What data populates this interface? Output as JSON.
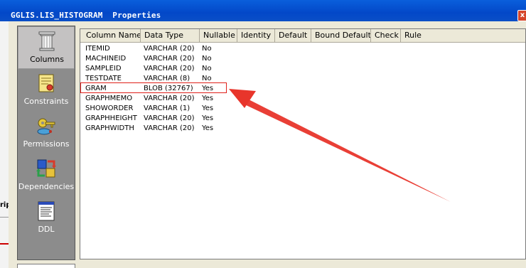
{
  "window": {
    "title": "GGLIS.LIS_HISTOGRAM  Properties",
    "close_label": "x"
  },
  "background": {
    "cell_label": "rip"
  },
  "sidebar": {
    "items": [
      {
        "label": "Columns",
        "icon": "column-pillar-icon",
        "active": true
      },
      {
        "label": "Constraints",
        "icon": "certificate-scroll-icon",
        "active": false
      },
      {
        "label": "Permissions",
        "icon": "keys-icon",
        "active": false
      },
      {
        "label": "Dependencies",
        "icon": "dependency-arrows-icon",
        "active": false
      },
      {
        "label": "DDL",
        "icon": "document-icon",
        "active": false
      }
    ]
  },
  "grid": {
    "headers": [
      "Column Name",
      "Data Type",
      "Nullable",
      "Identity",
      "Default",
      "Bound Default",
      "Check",
      "Rule"
    ],
    "rows": [
      {
        "name": "ITEMID",
        "type": "VARCHAR (20)",
        "nullable": "No"
      },
      {
        "name": "MACHINEID",
        "type": "VARCHAR (20)",
        "nullable": "No"
      },
      {
        "name": "SAMPLEID",
        "type": "VARCHAR (20)",
        "nullable": "No"
      },
      {
        "name": "TESTDATE",
        "type": "VARCHAR (8)",
        "nullable": "No"
      },
      {
        "name": "GRAM",
        "type": "BLOB (32767)",
        "nullable": "Yes"
      },
      {
        "name": "GRAPHMEMO",
        "type": "VARCHAR (20)",
        "nullable": "Yes"
      },
      {
        "name": "SHOWORDER",
        "type": "VARCHAR (1)",
        "nullable": "Yes"
      },
      {
        "name": "GRAPHHEIGHT",
        "type": "VARCHAR (20)",
        "nullable": "Yes"
      },
      {
        "name": "GRAPHWIDTH",
        "type": "VARCHAR (20)",
        "nullable": "Yes"
      }
    ],
    "highlighted_row": "GRAM"
  },
  "annotation": {
    "color": "#e8352b",
    "type": "arrow"
  },
  "colors": {
    "titlebar": "#0348c8",
    "sidebar": "#8c8c8c",
    "highlight": "#e0201a"
  }
}
